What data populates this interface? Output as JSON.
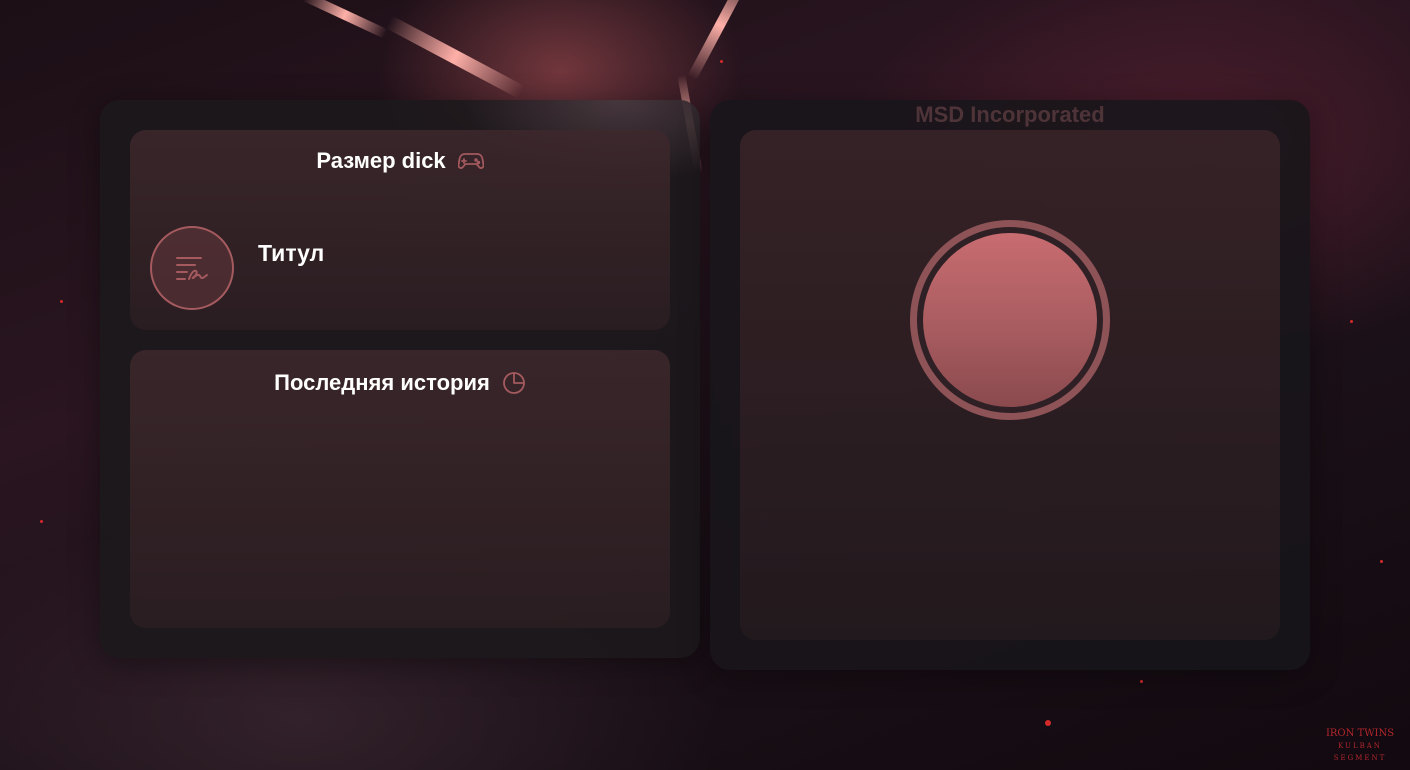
{
  "background": {
    "accent": "#ffb0a8",
    "ember": "#d42a2a"
  },
  "size_card": {
    "title": "Размер dick",
    "title_icon": "gamepad-icon"
  },
  "title_row": {
    "label": "Титул",
    "icon": "signature-icon"
  },
  "history_card": {
    "title": "Последняя история",
    "title_icon": "pie-chart-icon"
  },
  "brand": {
    "name": "MSD Incorporated"
  },
  "action_button": {
    "color": "#c86c70",
    "ring_color": "#8e5356"
  },
  "watermark": {
    "line1": "IRON TWINS",
    "line2": "KULBAN SEGMENT"
  }
}
